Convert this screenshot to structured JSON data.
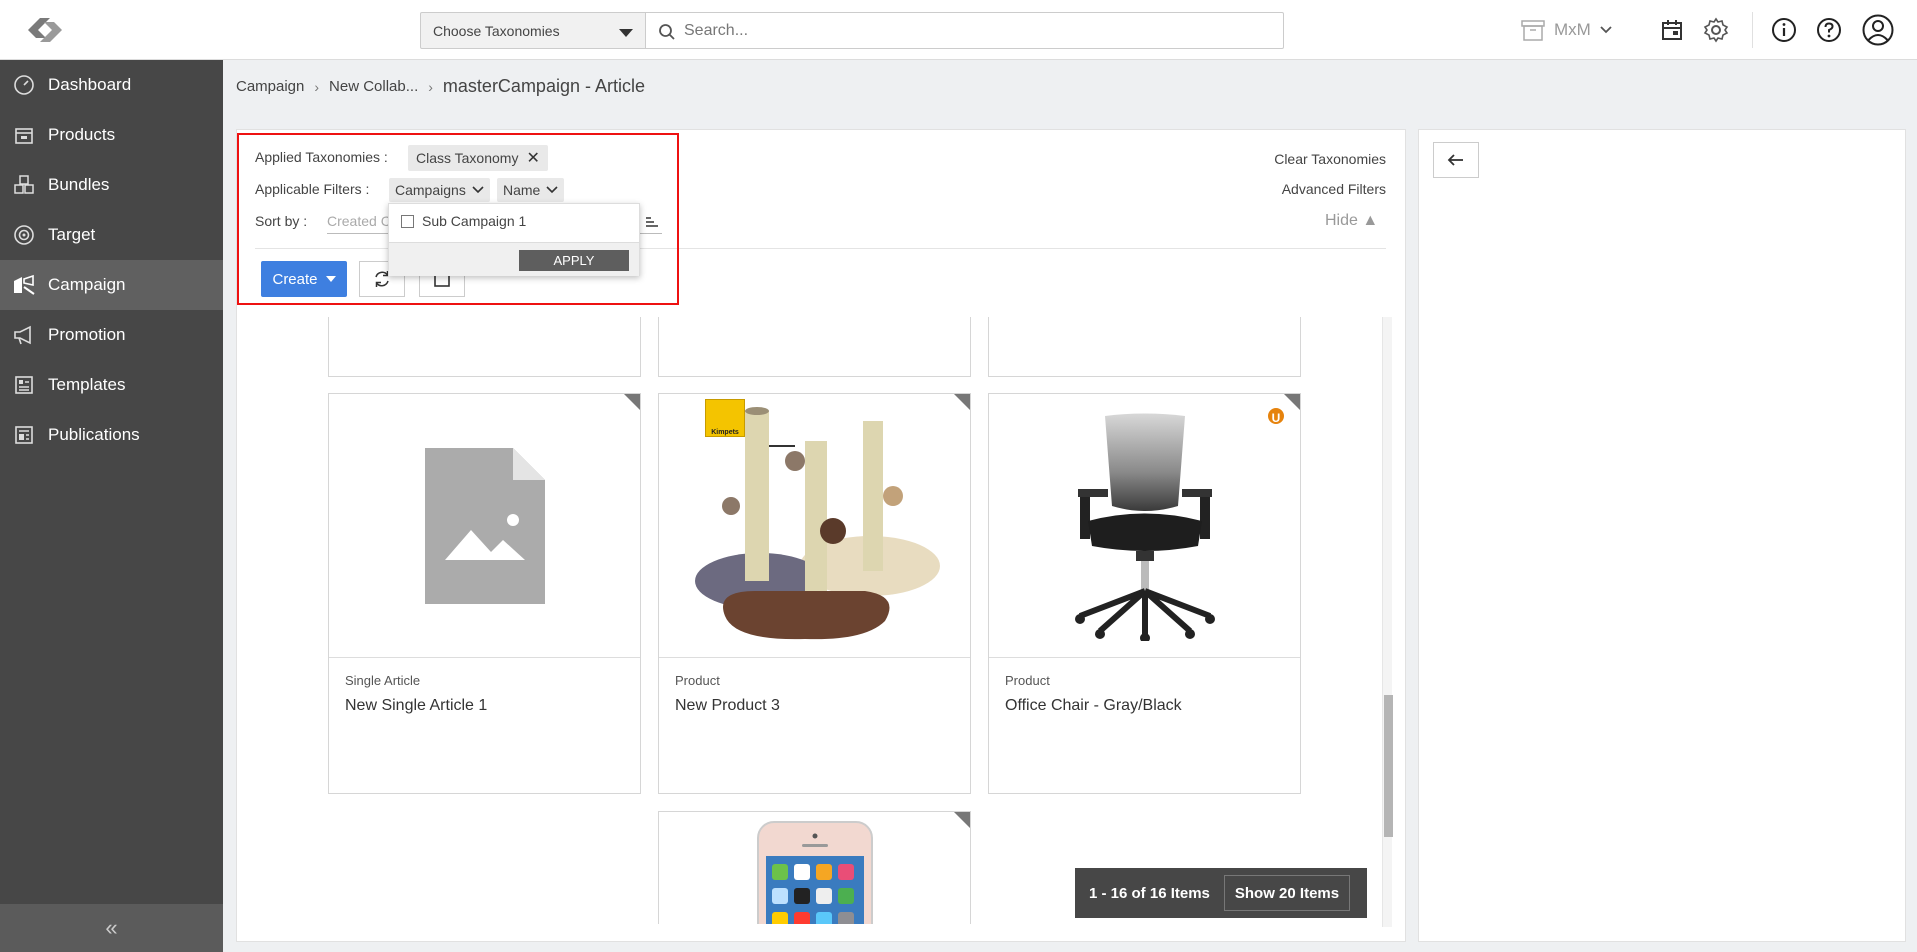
{
  "header": {
    "taxonomy_select": "Choose Taxonomies",
    "search_placeholder": "Search...",
    "tenant": "MxM"
  },
  "sidebar": {
    "items": [
      {
        "label": "Dashboard",
        "icon": "speedometer-icon"
      },
      {
        "label": "Products",
        "icon": "box-icon"
      },
      {
        "label": "Bundles",
        "icon": "cubes-icon"
      },
      {
        "label": "Target",
        "icon": "target-icon"
      },
      {
        "label": "Campaign",
        "icon": "campaign-icon",
        "active": true
      },
      {
        "label": "Promotion",
        "icon": "megaphone-icon"
      },
      {
        "label": "Templates",
        "icon": "template-icon"
      },
      {
        "label": "Publications",
        "icon": "publication-icon"
      }
    ],
    "collapse": "«"
  },
  "breadcrumb": {
    "items": [
      "Campaign",
      "New Collab..."
    ],
    "current": "masterCampaign - Article"
  },
  "filters": {
    "applied_label": "Applied Taxonomies :",
    "applied_chip": "Class Taxonomy",
    "applicable_label": "Applicable Filters :",
    "filter_campaigns": "Campaigns",
    "filter_name": "Name",
    "sort_label": "Sort by :",
    "sort_value": "Created C",
    "clear": "Clear Taxonomies",
    "advanced": "Advanced Filters",
    "hide": "Hide ▲"
  },
  "dropdown": {
    "option": "Sub Campaign 1",
    "apply": "APPLY"
  },
  "toolbar": {
    "create": "Create"
  },
  "cards": [
    {
      "type": "Single Article",
      "title": "New Single Article 1"
    },
    {
      "type": "Product",
      "title": "New Product 3",
      "brand": "Kimpets"
    },
    {
      "type": "Product",
      "title": "Office Chair - Gray/Black",
      "badge": "U"
    }
  ],
  "pager": {
    "count": "1 - 16 of 16 Items",
    "show": "Show 20 Items"
  }
}
